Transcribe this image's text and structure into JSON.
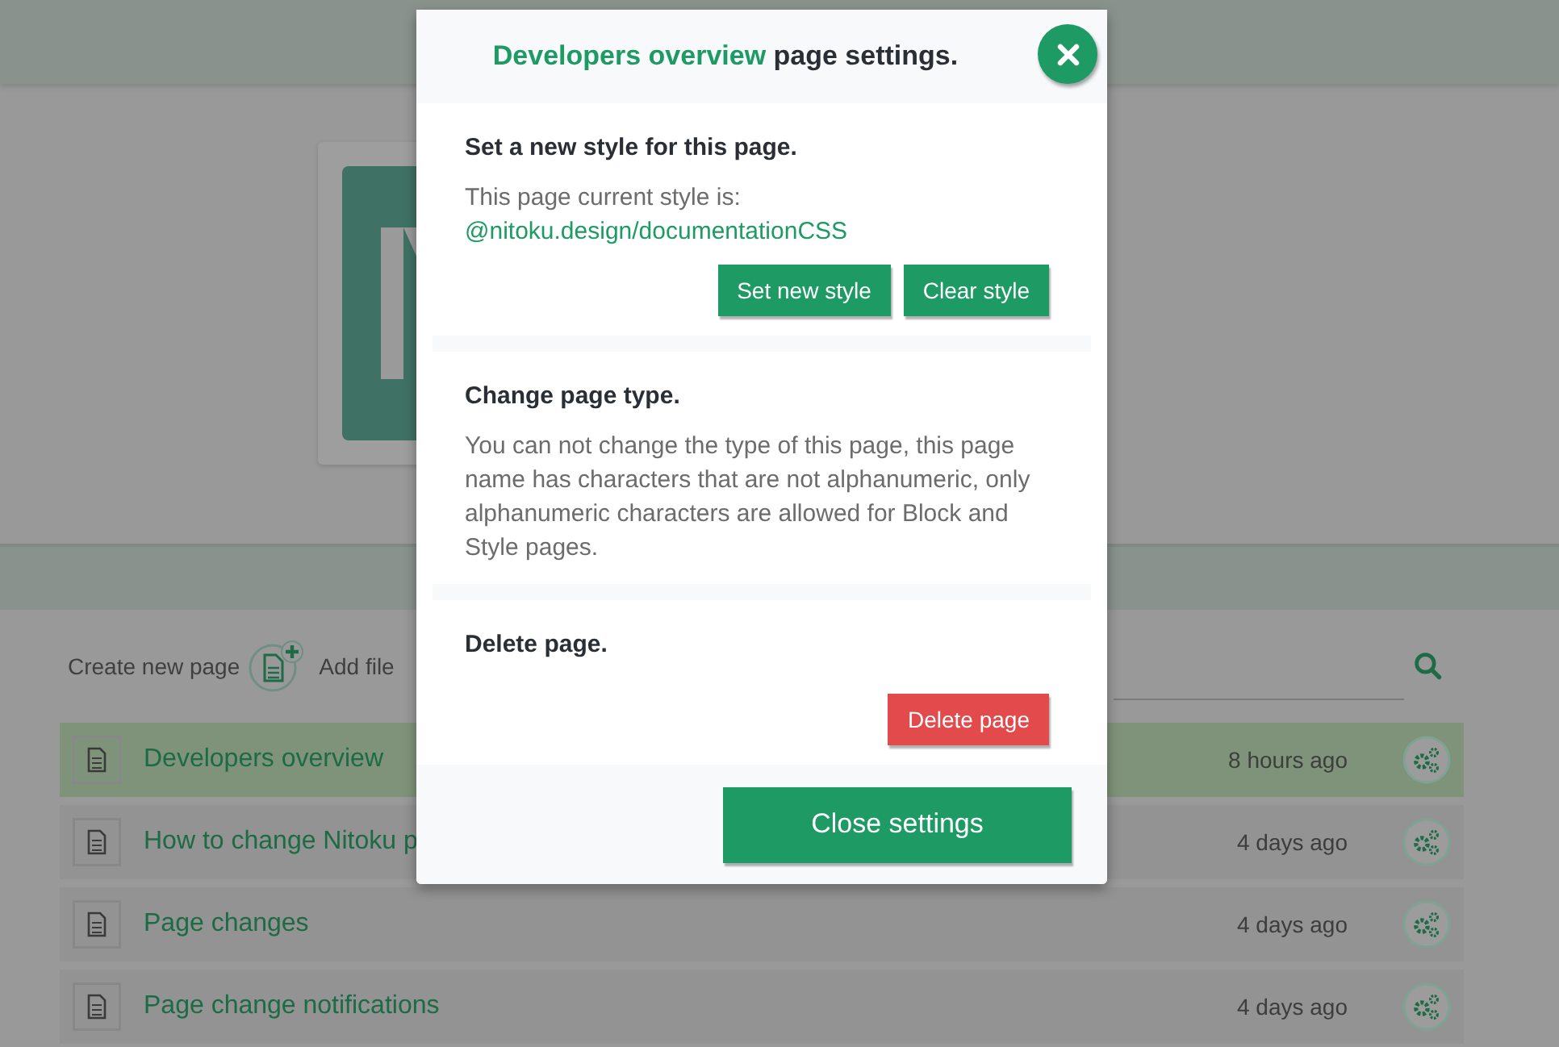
{
  "toolbar": {
    "create_label": "Create new page",
    "add_label": "Add file"
  },
  "pages": [
    {
      "name": "Developers overview",
      "time": "8 hours ago",
      "selected": true
    },
    {
      "name": "How to change Nitoku p",
      "time": "4 days ago",
      "selected": false
    },
    {
      "name": "Page changes",
      "time": "4 days ago",
      "selected": false
    },
    {
      "name": "Page change notifications",
      "time": "4 days ago",
      "selected": false
    }
  ],
  "modal": {
    "title_highlight": "Developers overview",
    "title_rest": "page settings.",
    "sections": [
      {
        "kind": "style",
        "heading": "Set a new style for this page.",
        "text": "This page current style is:",
        "link": "@nitoku.design/documentationCSS",
        "buttons": [
          "Set new style",
          "Clear style"
        ]
      },
      {
        "kind": "type",
        "heading": "Change page type.",
        "text": "You can not change the type of this page, this page name has characters that are not alphanumeric, only alphanumeric characters are allowed for Block and Style pages."
      },
      {
        "kind": "delete",
        "heading": "Delete page.",
        "buttons": [
          "Delete page"
        ]
      }
    ],
    "footer_button": "Close settings"
  }
}
